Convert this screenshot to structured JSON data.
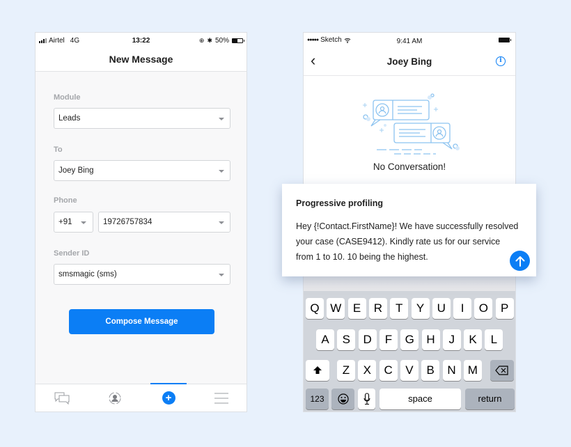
{
  "left_phone": {
    "status_bar": {
      "carrier": "Airtel",
      "network": "4G",
      "time": "13:22",
      "battery": "50%",
      "battery_level": 0.5
    },
    "nav": {
      "title": "New Message"
    },
    "form": {
      "module": {
        "label": "Module",
        "value": "Leads"
      },
      "to": {
        "label": "To",
        "value": "Joey Bing"
      },
      "phone": {
        "label": "Phone",
        "country_code": "+91",
        "number": "19726757834"
      },
      "sender_id": {
        "label": "Sender ID",
        "value": "smsmagic (sms)"
      }
    },
    "compose_button": "Compose Message",
    "tab_bar": {
      "items": [
        {
          "icon": "chat-bubbles-icon",
          "active": false
        },
        {
          "icon": "contact-sync-icon",
          "active": false
        },
        {
          "icon": "plus-circle-icon",
          "active": true
        },
        {
          "icon": "menu-icon",
          "active": false
        }
      ],
      "accent": "#0b7ef5"
    }
  },
  "right_phone": {
    "status_bar": {
      "carrier": "Sketch",
      "time": "9:41 AM"
    },
    "nav": {
      "title": "Joey Bing",
      "back_icon": "chevron-left-icon",
      "info_icon": "info-icon"
    },
    "empty_state": {
      "text": "No Conversation!",
      "icon": "conversation-illustration-icon"
    },
    "keyboard": {
      "row1": [
        "Q",
        "W",
        "E",
        "R",
        "T",
        "Y",
        "U",
        "I",
        "O",
        "P"
      ],
      "row2": [
        "A",
        "S",
        "D",
        "F",
        "G",
        "H",
        "J",
        "K",
        "L"
      ],
      "row3": [
        "Z",
        "X",
        "C",
        "V",
        "B",
        "N",
        "M"
      ],
      "numbers_key": "123",
      "space_key": "space",
      "return_key": "return"
    }
  },
  "template_card": {
    "title": "Progressive profiling",
    "message": "Hey {!Contact.FirstName}! We have successfully resolved your case (CASE9412). Kindly rate us for our service from 1 to 10. 10 being the highest.",
    "send_icon": "arrow-up-icon"
  },
  "colors": {
    "accent": "#0b7ef5",
    "background": "#e8f1fc",
    "keyboard": "#d1d5db"
  }
}
